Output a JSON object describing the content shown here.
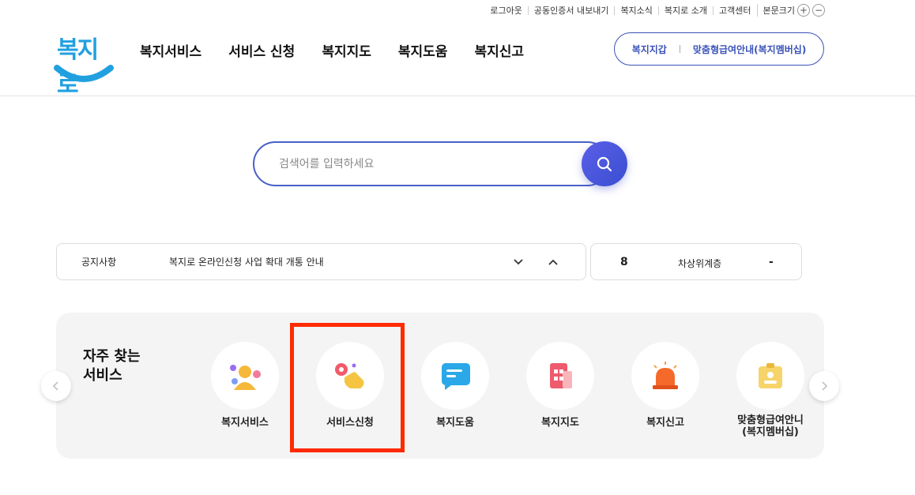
{
  "utility_links": [
    "로그아웃",
    "공동인증서 내보내기",
    "복지소식",
    "복지로 소개",
    "고객센터"
  ],
  "zoom": {
    "label": "본문크기",
    "plus": "+",
    "minus": "−"
  },
  "logo": {
    "text": "복지로"
  },
  "gnb": [
    "복지서비스",
    "서비스 신청",
    "복지지도",
    "복지도움",
    "복지신고"
  ],
  "top_pill": {
    "left": "복지지갑",
    "right": "맞춤형급여안내(복지멤버십)"
  },
  "search": {
    "placeholder": "검색어를 입력하세요"
  },
  "notice": {
    "label": "공지사항",
    "title": "복지로 온라인신청 사업 확대 개통 안내"
  },
  "rank": {
    "number": "8",
    "name": "차상위계층",
    "change": "-"
  },
  "frequent": {
    "title_line1": "자주 찾는",
    "title_line2": "서비스",
    "items": [
      {
        "label": "복지서비스",
        "icon": "people-icon"
      },
      {
        "label": "서비스신청",
        "icon": "hand-click-icon"
      },
      {
        "label": "복지도움",
        "icon": "chat-bubble-icon"
      },
      {
        "label": "복지지도",
        "icon": "building-icon"
      },
      {
        "label": "복지신고",
        "icon": "siren-icon"
      },
      {
        "label": "맞춤형급여안니\n(복지멤버십)",
        "icon": "id-card-icon"
      }
    ]
  },
  "colors": {
    "brand": "#3a52b8",
    "search_border": "#4a5fc8",
    "highlight": "#ff2a00",
    "logo": "#21a0e0"
  }
}
